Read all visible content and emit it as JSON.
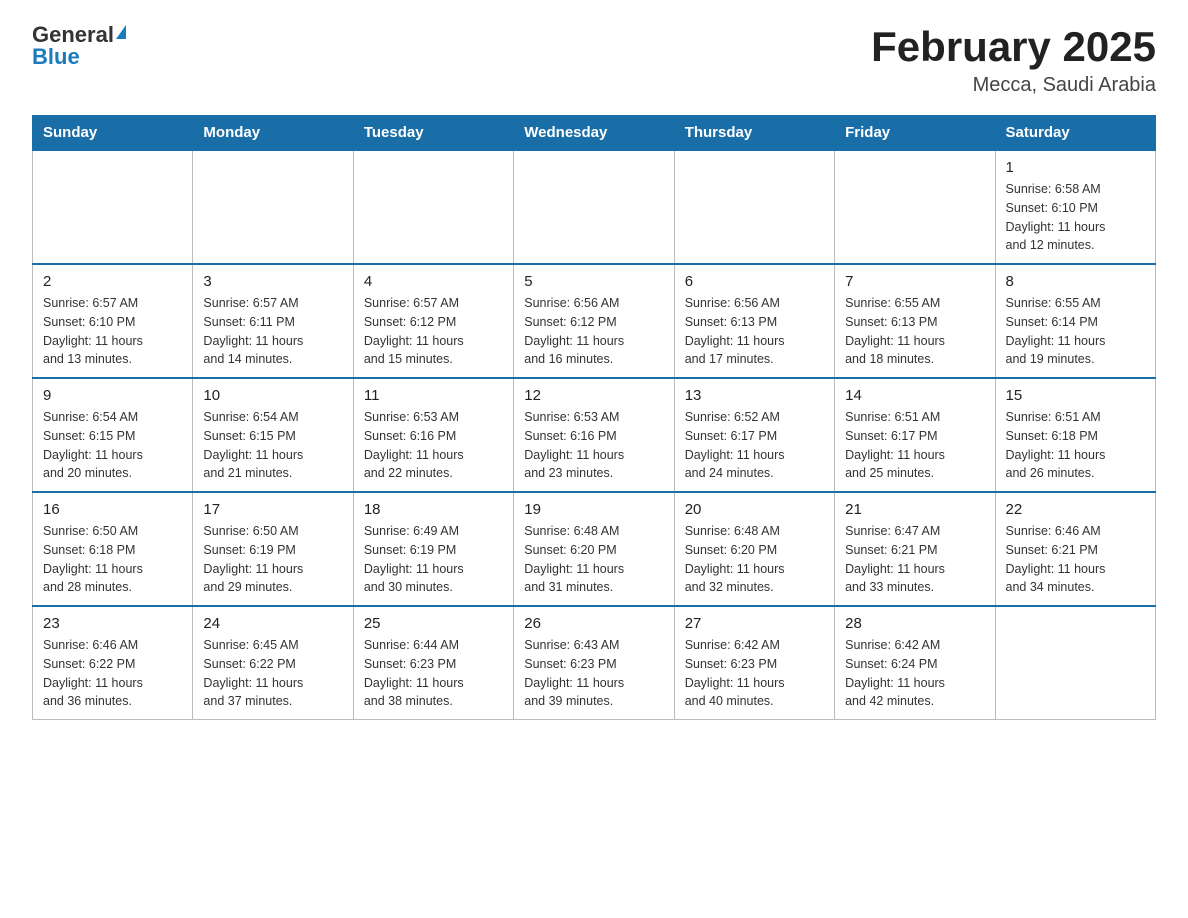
{
  "logo": {
    "general": "General",
    "triangle": "▲",
    "blue": "Blue"
  },
  "title": "February 2025",
  "subtitle": "Mecca, Saudi Arabia",
  "days_header": [
    "Sunday",
    "Monday",
    "Tuesday",
    "Wednesday",
    "Thursday",
    "Friday",
    "Saturday"
  ],
  "weeks": [
    {
      "days": [
        {
          "num": "",
          "info": "",
          "empty": true
        },
        {
          "num": "",
          "info": "",
          "empty": true
        },
        {
          "num": "",
          "info": "",
          "empty": true
        },
        {
          "num": "",
          "info": "",
          "empty": true
        },
        {
          "num": "",
          "info": "",
          "empty": true
        },
        {
          "num": "",
          "info": "",
          "empty": true
        },
        {
          "num": "1",
          "info": "Sunrise: 6:58 AM\nSunset: 6:10 PM\nDaylight: 11 hours\nand 12 minutes.",
          "empty": false
        }
      ]
    },
    {
      "days": [
        {
          "num": "2",
          "info": "Sunrise: 6:57 AM\nSunset: 6:10 PM\nDaylight: 11 hours\nand 13 minutes.",
          "empty": false
        },
        {
          "num": "3",
          "info": "Sunrise: 6:57 AM\nSunset: 6:11 PM\nDaylight: 11 hours\nand 14 minutes.",
          "empty": false
        },
        {
          "num": "4",
          "info": "Sunrise: 6:57 AM\nSunset: 6:12 PM\nDaylight: 11 hours\nand 15 minutes.",
          "empty": false
        },
        {
          "num": "5",
          "info": "Sunrise: 6:56 AM\nSunset: 6:12 PM\nDaylight: 11 hours\nand 16 minutes.",
          "empty": false
        },
        {
          "num": "6",
          "info": "Sunrise: 6:56 AM\nSunset: 6:13 PM\nDaylight: 11 hours\nand 17 minutes.",
          "empty": false
        },
        {
          "num": "7",
          "info": "Sunrise: 6:55 AM\nSunset: 6:13 PM\nDaylight: 11 hours\nand 18 minutes.",
          "empty": false
        },
        {
          "num": "8",
          "info": "Sunrise: 6:55 AM\nSunset: 6:14 PM\nDaylight: 11 hours\nand 19 minutes.",
          "empty": false
        }
      ]
    },
    {
      "days": [
        {
          "num": "9",
          "info": "Sunrise: 6:54 AM\nSunset: 6:15 PM\nDaylight: 11 hours\nand 20 minutes.",
          "empty": false
        },
        {
          "num": "10",
          "info": "Sunrise: 6:54 AM\nSunset: 6:15 PM\nDaylight: 11 hours\nand 21 minutes.",
          "empty": false
        },
        {
          "num": "11",
          "info": "Sunrise: 6:53 AM\nSunset: 6:16 PM\nDaylight: 11 hours\nand 22 minutes.",
          "empty": false
        },
        {
          "num": "12",
          "info": "Sunrise: 6:53 AM\nSunset: 6:16 PM\nDaylight: 11 hours\nand 23 minutes.",
          "empty": false
        },
        {
          "num": "13",
          "info": "Sunrise: 6:52 AM\nSunset: 6:17 PM\nDaylight: 11 hours\nand 24 minutes.",
          "empty": false
        },
        {
          "num": "14",
          "info": "Sunrise: 6:51 AM\nSunset: 6:17 PM\nDaylight: 11 hours\nand 25 minutes.",
          "empty": false
        },
        {
          "num": "15",
          "info": "Sunrise: 6:51 AM\nSunset: 6:18 PM\nDaylight: 11 hours\nand 26 minutes.",
          "empty": false
        }
      ]
    },
    {
      "days": [
        {
          "num": "16",
          "info": "Sunrise: 6:50 AM\nSunset: 6:18 PM\nDaylight: 11 hours\nand 28 minutes.",
          "empty": false
        },
        {
          "num": "17",
          "info": "Sunrise: 6:50 AM\nSunset: 6:19 PM\nDaylight: 11 hours\nand 29 minutes.",
          "empty": false
        },
        {
          "num": "18",
          "info": "Sunrise: 6:49 AM\nSunset: 6:19 PM\nDaylight: 11 hours\nand 30 minutes.",
          "empty": false
        },
        {
          "num": "19",
          "info": "Sunrise: 6:48 AM\nSunset: 6:20 PM\nDaylight: 11 hours\nand 31 minutes.",
          "empty": false
        },
        {
          "num": "20",
          "info": "Sunrise: 6:48 AM\nSunset: 6:20 PM\nDaylight: 11 hours\nand 32 minutes.",
          "empty": false
        },
        {
          "num": "21",
          "info": "Sunrise: 6:47 AM\nSunset: 6:21 PM\nDaylight: 11 hours\nand 33 minutes.",
          "empty": false
        },
        {
          "num": "22",
          "info": "Sunrise: 6:46 AM\nSunset: 6:21 PM\nDaylight: 11 hours\nand 34 minutes.",
          "empty": false
        }
      ]
    },
    {
      "days": [
        {
          "num": "23",
          "info": "Sunrise: 6:46 AM\nSunset: 6:22 PM\nDaylight: 11 hours\nand 36 minutes.",
          "empty": false
        },
        {
          "num": "24",
          "info": "Sunrise: 6:45 AM\nSunset: 6:22 PM\nDaylight: 11 hours\nand 37 minutes.",
          "empty": false
        },
        {
          "num": "25",
          "info": "Sunrise: 6:44 AM\nSunset: 6:23 PM\nDaylight: 11 hours\nand 38 minutes.",
          "empty": false
        },
        {
          "num": "26",
          "info": "Sunrise: 6:43 AM\nSunset: 6:23 PM\nDaylight: 11 hours\nand 39 minutes.",
          "empty": false
        },
        {
          "num": "27",
          "info": "Sunrise: 6:42 AM\nSunset: 6:23 PM\nDaylight: 11 hours\nand 40 minutes.",
          "empty": false
        },
        {
          "num": "28",
          "info": "Sunrise: 6:42 AM\nSunset: 6:24 PM\nDaylight: 11 hours\nand 42 minutes.",
          "empty": false
        },
        {
          "num": "",
          "info": "",
          "empty": true
        }
      ]
    }
  ]
}
